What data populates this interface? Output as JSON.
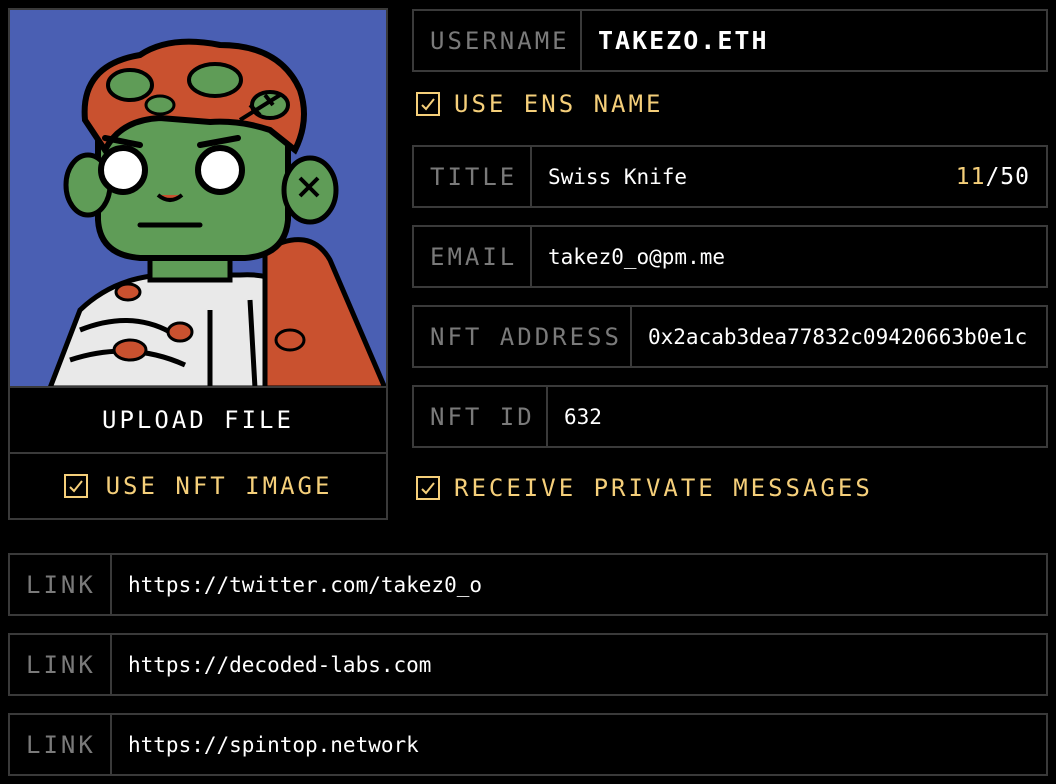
{
  "avatar": {
    "upload_label": "UPLOAD FILE",
    "use_nft_image_label": "USE NFT IMAGE",
    "use_nft_image_checked": true,
    "background_color": "#4a5fb3"
  },
  "username": {
    "label": "USERNAME",
    "value": "TAKEZO.ETH"
  },
  "use_ens": {
    "label": "USE ENS NAME",
    "checked": true
  },
  "title": {
    "label": "TITLE",
    "value": "Swiss Knife",
    "count_current": "11",
    "count_sep": "/",
    "count_max": "50"
  },
  "email": {
    "label": "EMAIL",
    "value": "takez0_o@pm.me"
  },
  "nft_address": {
    "label": "NFT ADDRESS",
    "value": "0x2acab3dea77832c09420663b0e1c"
  },
  "nft_id": {
    "label": "NFT ID",
    "value": "632"
  },
  "private_messages": {
    "label": "RECEIVE PRIVATE MESSAGES",
    "checked": true
  },
  "links": [
    {
      "label": "LINK",
      "value": "https://twitter.com/takez0_o"
    },
    {
      "label": "LINK",
      "value": "https://decoded-labs.com"
    },
    {
      "label": "LINK",
      "value": "https://spintop.network"
    }
  ],
  "colors": {
    "accent": "#f5cf7a",
    "border": "#3a3a3a",
    "muted_label": "#7a7a7a",
    "background": "#000000"
  }
}
